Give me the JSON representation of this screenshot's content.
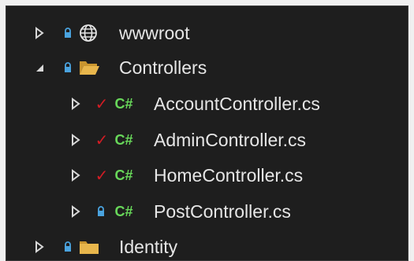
{
  "solution_explorer": {
    "items": [
      {
        "label": "wwwroot",
        "type": "folder-web",
        "state": "collapsed",
        "source_control": "locked",
        "icons": [
          "expand-arrow-icon",
          "lock-icon",
          "globe-icon"
        ]
      },
      {
        "label": "Controllers",
        "type": "folder",
        "state": "expanded",
        "source_control": "locked",
        "icons": [
          "collapse-arrow-icon",
          "lock-icon",
          "open-folder-icon"
        ]
      },
      {
        "label": "AccountController.cs",
        "type": "csharp-file",
        "state": "collapsed",
        "source_control": "checked-out",
        "file_badge": "C#",
        "icons": [
          "expand-arrow-icon",
          "checkmark-icon",
          "csharp-file-icon"
        ]
      },
      {
        "label": "AdminController.cs",
        "type": "csharp-file",
        "state": "collapsed",
        "source_control": "checked-out",
        "file_badge": "C#",
        "icons": [
          "expand-arrow-icon",
          "checkmark-icon",
          "csharp-file-icon"
        ]
      },
      {
        "label": "HomeController.cs",
        "type": "csharp-file",
        "state": "collapsed",
        "source_control": "checked-out",
        "file_badge": "C#",
        "icons": [
          "expand-arrow-icon",
          "checkmark-icon",
          "csharp-file-icon"
        ]
      },
      {
        "label": "PostController.cs",
        "type": "csharp-file",
        "state": "collapsed",
        "source_control": "locked",
        "file_badge": "C#",
        "icons": [
          "expand-arrow-icon",
          "lock-icon",
          "csharp-file-icon"
        ]
      },
      {
        "label": "Identity",
        "type": "folder",
        "state": "collapsed",
        "source_control": "locked",
        "icons": [
          "expand-arrow-icon",
          "lock-icon",
          "folder-icon"
        ]
      }
    ]
  },
  "colors": {
    "background": "#1e1e1e",
    "text": "#e6e6e6",
    "arrow": "#d8d8d8",
    "lock": "#4aa3df",
    "checkmark": "#d21c24",
    "csharp": "#68d85a",
    "folder": "#e8b64c"
  }
}
